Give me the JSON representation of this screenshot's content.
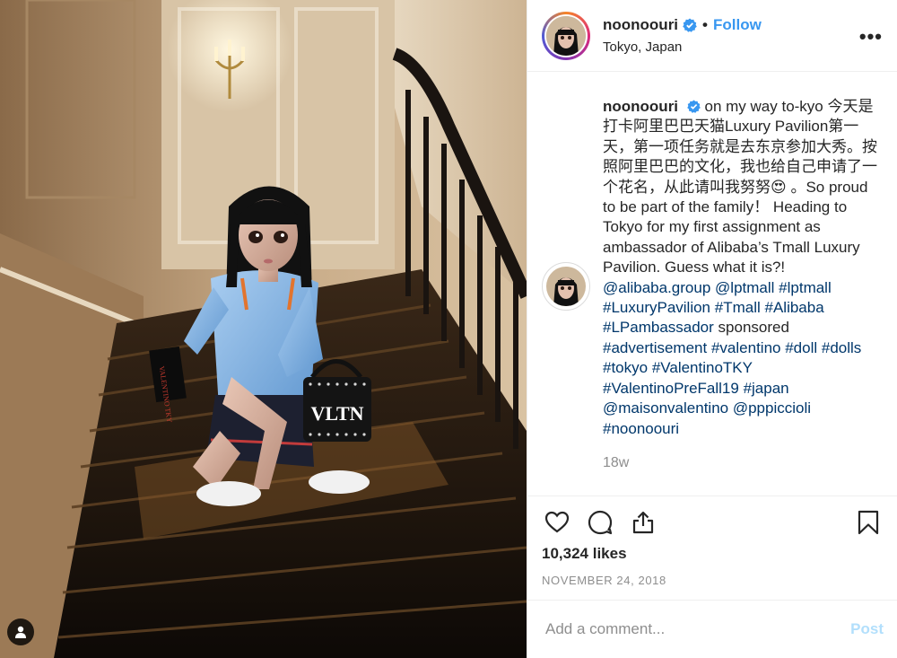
{
  "post": {
    "username": "noonoouri",
    "follow_label": "Follow",
    "separator": "•",
    "location": "Tokyo, Japan",
    "more_label": "•••"
  },
  "caption": {
    "username": "noonoouri",
    "text_1": "on my way to-kyo 今天是打卡阿里巴巴天猫Luxury Pavilion第一天，第一项任务就是去东京参加大秀。按照阿里巴巴的文化，我也给自己申请了一个花名，从此请叫我努努",
    "emoji": "😍",
    "text_2": " 。So proud to be part of the family！ Heading to Tokyo for my first assignment as ambassador of Alibaba’s Tmall Luxury Pavilion. Guess what it is?! ",
    "tags_a": [
      "@alibaba.group",
      "@lptmall",
      "#lptmall",
      "#LuxuryPavilion",
      "#Tmall",
      "#Alibaba",
      "#LPambassador"
    ],
    "sponsored": "sponsored",
    "tags_b": [
      "#advertisement",
      "#valentino",
      "#doll",
      "#dolls",
      "#tokyo",
      "#ValentinoTKY",
      "#ValentinoPreFall19",
      "#japan",
      "@maisonvalentino",
      "@pppiccioli",
      "#noonoouri"
    ],
    "time_ago": "18w"
  },
  "actions": {
    "icons": [
      "heart-icon",
      "comment-icon",
      "share-icon",
      "bookmark-icon"
    ],
    "likes": "10,324 likes",
    "date": "NOVEMBER 24, 2018"
  },
  "comment_box": {
    "placeholder": "Add a comment...",
    "post_label": "Post"
  },
  "photo": {
    "bag_text": "VLTN",
    "box_text": "VALENTINO TKY"
  },
  "colors": {
    "link": "#00376b",
    "follow": "#3897f0",
    "verified": "#3897f0",
    "muted": "#8e8e8e",
    "post_disabled": "#b2dffc"
  }
}
